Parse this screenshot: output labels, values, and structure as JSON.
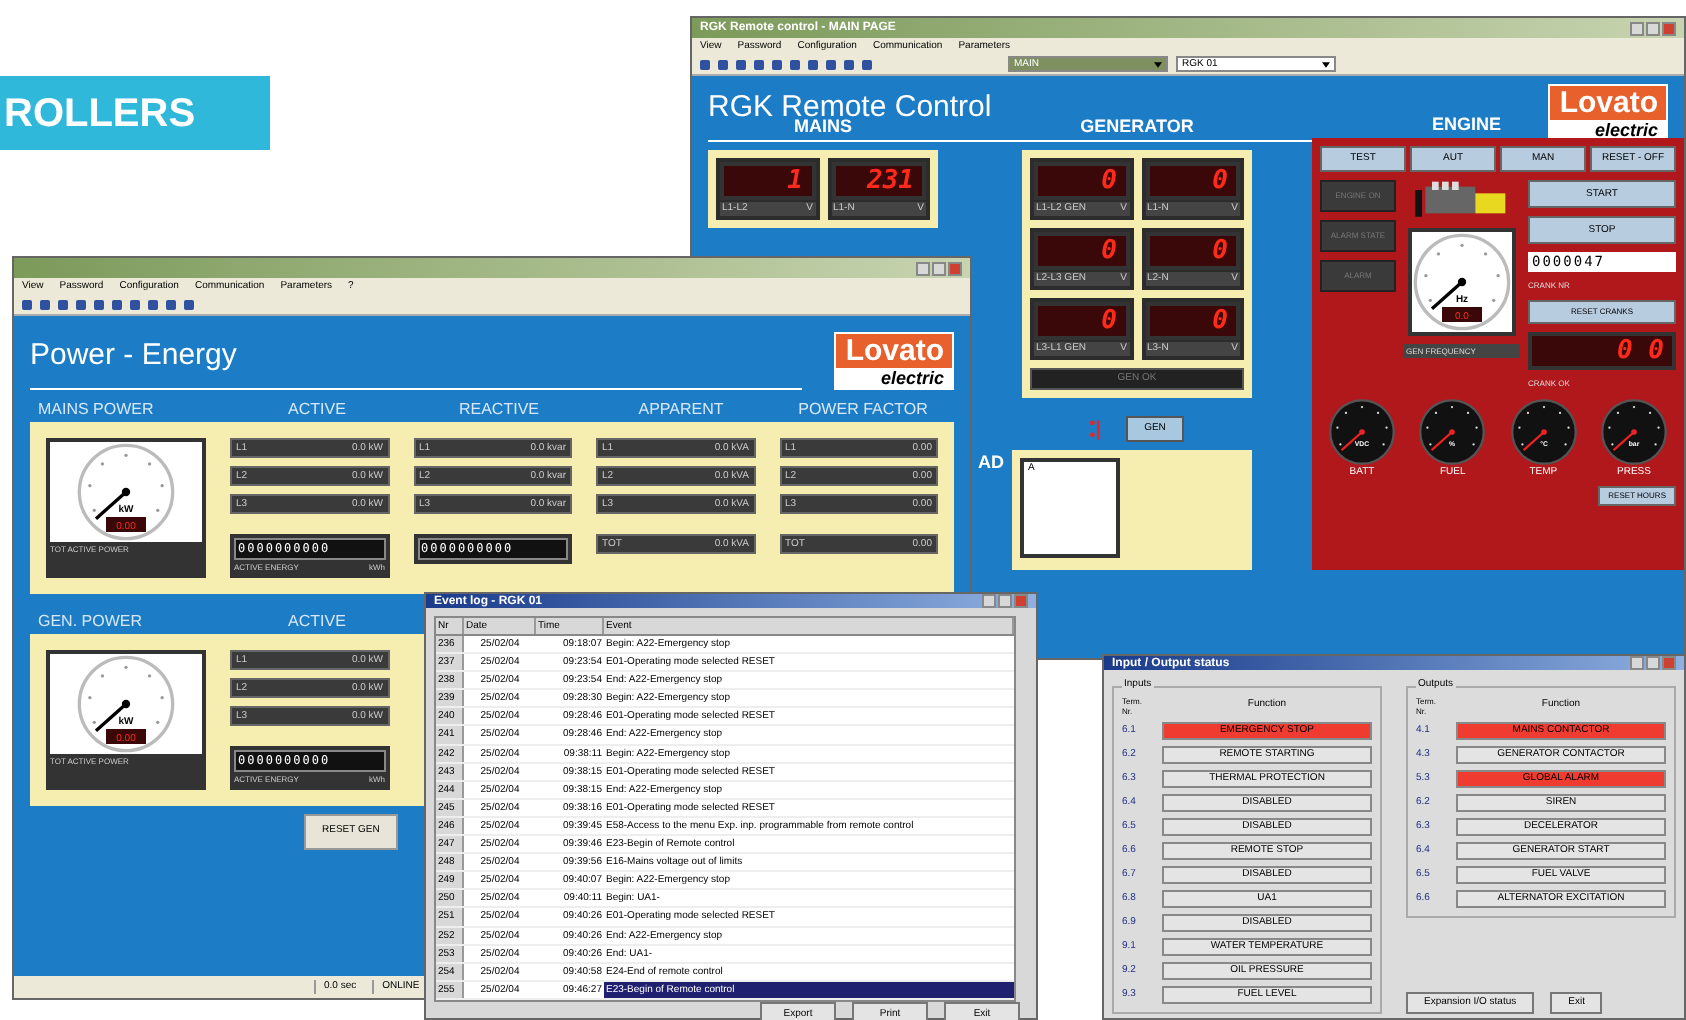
{
  "banner": {
    "text": "ROLLERS"
  },
  "remote_window": {
    "title": "RGK Remote control - MAIN PAGE",
    "menu": [
      "View",
      "Password",
      "Configuration",
      "Communication",
      "Parameters"
    ],
    "selectors": [
      "MAIN",
      "RGK 01"
    ],
    "heading": "RGK Remote Control",
    "logo": {
      "name": "Lovato",
      "sub": "electric"
    },
    "mains": {
      "title": "MAINS",
      "displays": [
        {
          "value": "1",
          "label": "L1-L2",
          "unit": "V"
        },
        {
          "value": "231",
          "label": "L1-N",
          "unit": "V"
        }
      ]
    },
    "generator": {
      "title": "GENERATOR",
      "displays": [
        {
          "value": "0",
          "label": "L1-L2 GEN",
          "unit": "V"
        },
        {
          "value": "0",
          "label": "L1-N",
          "unit": "V"
        },
        {
          "value": "0",
          "label": "L2-L3 GEN",
          "unit": "V"
        },
        {
          "value": "0",
          "label": "L2-N",
          "unit": "V"
        },
        {
          "value": "0",
          "label": "L3-L1 GEN",
          "unit": "V"
        },
        {
          "value": "0",
          "label": "L3-N",
          "unit": "V"
        }
      ],
      "status": "GEN OK",
      "button": "GEN"
    },
    "load": {
      "title": "AD",
      "meter_unit": "A"
    },
    "engine": {
      "title": "ENGINE",
      "modes": [
        "TEST",
        "AUT",
        "MAN",
        "RESET - OFF"
      ],
      "lamps": [
        "ENGINE ON",
        "ALARM STATE",
        "ALARM"
      ],
      "commands": [
        "START",
        "STOP"
      ],
      "crank_counter": "0000047",
      "crank_label": "CRANK NR",
      "reset_cranks": "RESET CRANKS",
      "crank_ok": {
        "value": "0 0",
        "label": "CRANK OK"
      },
      "frequency": {
        "unit": "Hz",
        "value": "0.0",
        "label": "GEN FREQUENCY"
      },
      "gauges": [
        {
          "unit": "VDC",
          "label": "BATT"
        },
        {
          "unit": "%",
          "label": "FUEL"
        },
        {
          "unit": "°C",
          "label": "TEMP"
        },
        {
          "unit": "bar",
          "label": "PRESS"
        }
      ],
      "reset_hours": "RESET HOURS"
    }
  },
  "power_window": {
    "menu": [
      "View",
      "Password",
      "Configuration",
      "Communication",
      "Parameters",
      "?"
    ],
    "heading": "Power - Energy",
    "logo": {
      "name": "Lovato",
      "sub": "electric"
    },
    "sections": [
      {
        "title": "MAINS POWER",
        "gauge": {
          "unit": "kW",
          "value": "0.00",
          "label": "TOT ACTIVE POWER"
        },
        "columns": [
          {
            "header": "ACTIVE",
            "rows": [
              {
                "label": "L1",
                "value": "0.0",
                "unit": "kW"
              },
              {
                "label": "L2",
                "value": "0.0",
                "unit": "kW"
              },
              {
                "label": "L3",
                "value": "0.0",
                "unit": "kW"
              }
            ],
            "counter": {
              "digits": "0000000000",
              "label": "ACTIVE ENERGY",
              "unit": "kWh"
            }
          },
          {
            "header": "REACTIVE",
            "rows": [
              {
                "label": "L1",
                "value": "0.0",
                "unit": "kvar"
              },
              {
                "label": "L2",
                "value": "0.0",
                "unit": "kvar"
              },
              {
                "label": "L3",
                "value": "0.0",
                "unit": "kvar"
              }
            ],
            "counter": {
              "digits": "0000000000"
            }
          },
          {
            "header": "APPARENT",
            "rows": [
              {
                "label": "L1",
                "value": "0.0",
                "unit": "kVA"
              },
              {
                "label": "L2",
                "value": "0.0",
                "unit": "kVA"
              },
              {
                "label": "L3",
                "value": "0.0",
                "unit": "kVA"
              }
            ],
            "total": {
              "label": "TOT",
              "value": "0.0",
              "unit": "kVA"
            }
          },
          {
            "header": "POWER FACTOR",
            "rows": [
              {
                "label": "L1",
                "value": "0.00"
              },
              {
                "label": "L2",
                "value": "0.00"
              },
              {
                "label": "L3",
                "value": "0.00"
              }
            ],
            "total": {
              "label": "TOT",
              "value": "0.00"
            }
          }
        ]
      },
      {
        "title": "GEN. POWER",
        "gauge": {
          "unit": "kW",
          "value": "0.00",
          "label": "TOT ACTIVE POWER"
        },
        "columns": [
          {
            "header": "ACTIVE",
            "rows": [
              {
                "label": "L1",
                "value": "0.0",
                "unit": "kW"
              },
              {
                "label": "L2",
                "value": "0.0",
                "unit": "kW"
              },
              {
                "label": "L3",
                "value": "0.0",
                "unit": "kW"
              }
            ],
            "counter": {
              "digits": "0000000000",
              "label": "ACTIVE ENERGY",
              "unit": "kWh"
            }
          }
        ]
      }
    ],
    "reset_button": "RESET GEN",
    "status_bar": [
      "0.0 sec",
      "ONLINE"
    ]
  },
  "event_log": {
    "title": "Event log - RGK 01",
    "columns": [
      "Nr",
      "Date",
      "Time",
      "Event"
    ],
    "rows": [
      {
        "nr": "236",
        "date": "25/02/04",
        "time": "09:18:07",
        "event": "Begin: A22-Emergency stop",
        "selected": false
      },
      {
        "nr": "237",
        "date": "25/02/04",
        "time": "09:23:54",
        "event": "E01-Operating mode selected RESET",
        "selected": false
      },
      {
        "nr": "238",
        "date": "25/02/04",
        "time": "09:23:54",
        "event": "End: A22-Emergency stop",
        "selected": false
      },
      {
        "nr": "239",
        "date": "25/02/04",
        "time": "09:28:30",
        "event": "Begin: A22-Emergency stop",
        "selected": false
      },
      {
        "nr": "240",
        "date": "25/02/04",
        "time": "09:28:46",
        "event": "E01-Operating mode selected RESET",
        "selected": false
      },
      {
        "nr": "241",
        "date": "25/02/04",
        "time": "09:28:46",
        "event": "End: A22-Emergency stop",
        "selected": false
      },
      {
        "nr": "242",
        "date": "25/02/04",
        "time": "09:38:11",
        "event": "Begin: A22-Emergency stop",
        "selected": false
      },
      {
        "nr": "243",
        "date": "25/02/04",
        "time": "09:38:15",
        "event": "E01-Operating mode selected RESET",
        "selected": false
      },
      {
        "nr": "244",
        "date": "25/02/04",
        "time": "09:38:15",
        "event": "End: A22-Emergency stop",
        "selected": false
      },
      {
        "nr": "245",
        "date": "25/02/04",
        "time": "09:38:16",
        "event": "E01-Operating mode selected RESET",
        "selected": false
      },
      {
        "nr": "246",
        "date": "25/02/04",
        "time": "09:39:45",
        "event": "E58-Access to the menu Exp. inp. programmable from remote control",
        "selected": false
      },
      {
        "nr": "247",
        "date": "25/02/04",
        "time": "09:39:46",
        "event": "E23-Begin of Remote control",
        "selected": false
      },
      {
        "nr": "248",
        "date": "25/02/04",
        "time": "09:39:56",
        "event": "E16-Mains voltage out of limits",
        "selected": false
      },
      {
        "nr": "249",
        "date": "25/02/04",
        "time": "09:40:07",
        "event": "Begin: A22-Emergency stop",
        "selected": false
      },
      {
        "nr": "250",
        "date": "25/02/04",
        "time": "09:40:11",
        "event": "Begin: UA1-",
        "selected": false
      },
      {
        "nr": "251",
        "date": "25/02/04",
        "time": "09:40:26",
        "event": "E01-Operating mode selected RESET",
        "selected": false
      },
      {
        "nr": "252",
        "date": "25/02/04",
        "time": "09:40:26",
        "event": "End: A22-Emergency stop",
        "selected": false
      },
      {
        "nr": "253",
        "date": "25/02/04",
        "time": "09:40:26",
        "event": "End: UA1-",
        "selected": false
      },
      {
        "nr": "254",
        "date": "25/02/04",
        "time": "09:40:58",
        "event": "E24-End of remote control",
        "selected": false
      },
      {
        "nr": "255",
        "date": "25/02/04",
        "time": "09:46:27",
        "event": "E23-Begin of Remote control",
        "selected": true
      }
    ],
    "buttons": [
      "Export",
      "Print",
      "Exit"
    ]
  },
  "io_window": {
    "title": "Input / Output status",
    "inputs": {
      "label": "Inputs",
      "columns": [
        "Term. Nr.",
        "Function"
      ],
      "items": [
        {
          "nr": "6.1",
          "function": "EMERGENCY STOP",
          "on": true
        },
        {
          "nr": "6.2",
          "function": "REMOTE STARTING",
          "on": false
        },
        {
          "nr": "6.3",
          "function": "THERMAL PROTECTION",
          "on": false
        },
        {
          "nr": "6.4",
          "function": "DISABLED",
          "on": false
        },
        {
          "nr": "6.5",
          "function": "DISABLED",
          "on": false
        },
        {
          "nr": "6.6",
          "function": "REMOTE STOP",
          "on": false
        },
        {
          "nr": "6.7",
          "function": "DISABLED",
          "on": false
        },
        {
          "nr": "6.8",
          "function": "UA1",
          "on": false
        },
        {
          "nr": "6.9",
          "function": "DISABLED",
          "on": false
        },
        {
          "nr": "9.1",
          "function": "WATER TEMPERATURE",
          "on": false
        },
        {
          "nr": "9.2",
          "function": "OIL PRESSURE",
          "on": false
        },
        {
          "nr": "9.3",
          "function": "FUEL LEVEL",
          "on": false
        }
      ]
    },
    "outputs": {
      "label": "Outputs",
      "columns": [
        "Term. Nr.",
        "Function"
      ],
      "items": [
        {
          "nr": "4.1",
          "function": "MAINS CONTACTOR",
          "on": true
        },
        {
          "nr": "4.3",
          "function": "GENERATOR CONTACTOR",
          "on": false
        },
        {
          "nr": "5.3",
          "function": "GLOBAL ALARM",
          "on": true
        },
        {
          "nr": "6.2",
          "function": "SIREN",
          "on": false
        },
        {
          "nr": "6.3",
          "function": "DECELERATOR",
          "on": false
        },
        {
          "nr": "6.4",
          "function": "GENERATOR START",
          "on": false
        },
        {
          "nr": "6.5",
          "function": "FUEL VALVE",
          "on": false
        },
        {
          "nr": "6.6",
          "function": "ALTERNATOR EXCITATION",
          "on": false
        }
      ]
    },
    "buttons": [
      "Expansion I/O status",
      "Exit"
    ]
  }
}
